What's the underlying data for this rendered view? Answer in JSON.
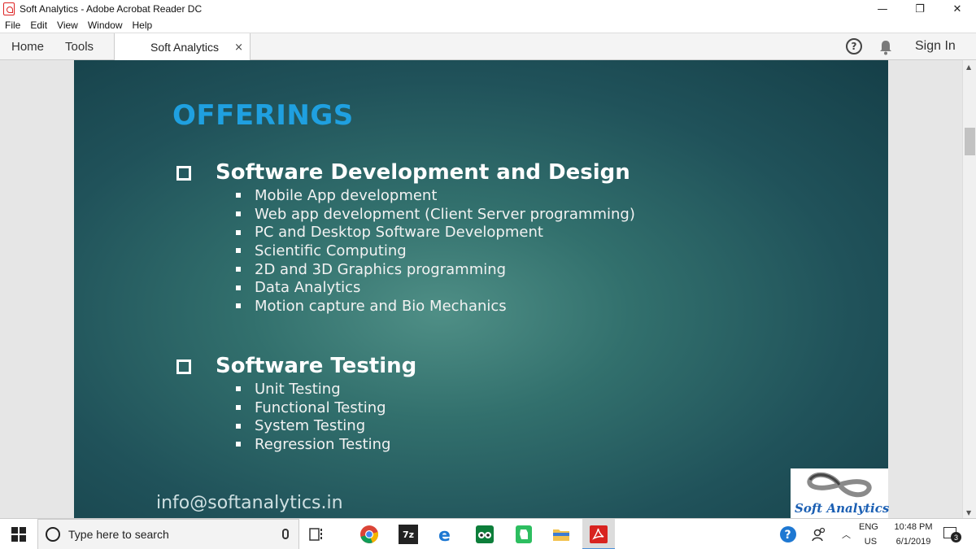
{
  "window": {
    "title": "Soft Analytics - Adobe Acrobat Reader DC",
    "minimize": "—",
    "restore": "❐",
    "close": "✕"
  },
  "menu": [
    "File",
    "Edit",
    "View",
    "Window",
    "Help"
  ],
  "toolbar": {
    "home": "Home",
    "tools": "Tools",
    "doc_tab": "Soft Analytics",
    "close_tab": "×",
    "help": "?",
    "sign_in": "Sign In"
  },
  "slide": {
    "title": "OFFERINGS",
    "sections": [
      {
        "heading": "Software Development and Design",
        "items": [
          "Mobile App development",
          "Web app development (Client Server programming)",
          "PC and Desktop Software Development",
          "Scientific Computing",
          "2D and 3D Graphics programming",
          "Data Analytics",
          "Motion capture and Bio Mechanics"
        ]
      },
      {
        "heading": "Software Testing",
        "items": [
          "Unit Testing",
          "Functional Testing",
          "System Testing",
          "Regression Testing"
        ]
      }
    ],
    "email": "info@softanalytics.in",
    "logo_text": "Soft Analytics",
    "title_color": "#1fa0e0"
  },
  "taskbar": {
    "search_placeholder": "Type here to search",
    "lang_top": "ENG",
    "lang_bottom": "US",
    "time": "10:48 PM",
    "date": "6/1/2019",
    "notification_count": "3",
    "app_7z": "7z"
  }
}
